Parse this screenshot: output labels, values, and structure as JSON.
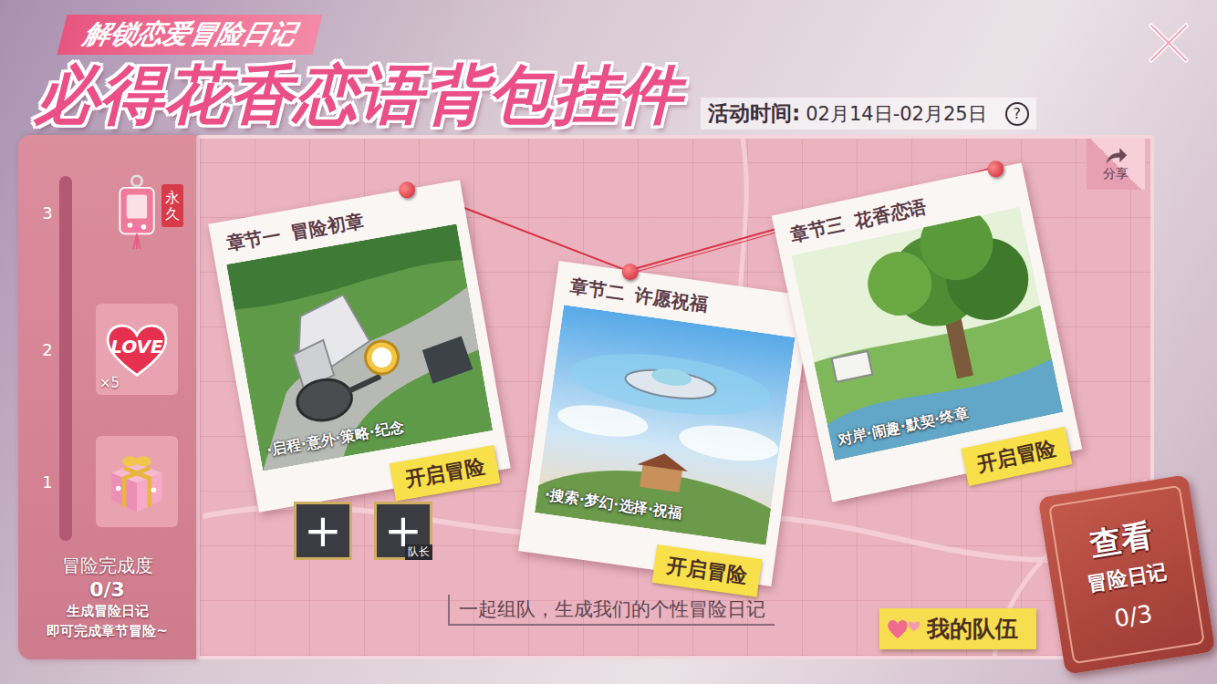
{
  "header": {
    "banner": "解锁恋爱冒险日记",
    "title": "必得花香恋语背包挂件",
    "time_label": "活动时间:",
    "time_range": "02月14日-02月25日",
    "help": "?"
  },
  "share": {
    "label": "分享"
  },
  "rewards": {
    "tiers": [
      {
        "level": "3",
        "kind": "charm",
        "tag": "永久"
      },
      {
        "level": "2",
        "kind": "heart",
        "text": "LOVE",
        "count": "×5"
      },
      {
        "level": "1",
        "kind": "gift"
      }
    ],
    "level": 0,
    "progress_label": "冒险完成度",
    "progress_value": "0/3",
    "hint": [
      "生成冒险日记",
      "即可完成章节冒险~"
    ]
  },
  "chapters": [
    {
      "chapter": "章节一",
      "name": "冒险初章",
      "tags": "·启程·意外·策略·纪念",
      "button": "开启冒险",
      "kind": "camp"
    },
    {
      "chapter": "章节二",
      "name": "许愿祝福",
      "tags": "·搜索·梦幻·选择·祝福",
      "button": "开启冒险",
      "kind": "sky"
    },
    {
      "chapter": "章节三",
      "name": "花香恋语",
      "tags": "对岸·闹趣·默契·终章",
      "button": "开启冒险",
      "kind": "tree"
    }
  ],
  "team": {
    "slots": [
      {
        "icon": "+"
      },
      {
        "icon": "+",
        "label": "队长"
      }
    ],
    "caption": "一起组队，生成我们的个性冒险日记",
    "button": "我的队伍"
  },
  "diary": {
    "line1": "查看",
    "line2": "冒险日记",
    "count": "0/3"
  }
}
